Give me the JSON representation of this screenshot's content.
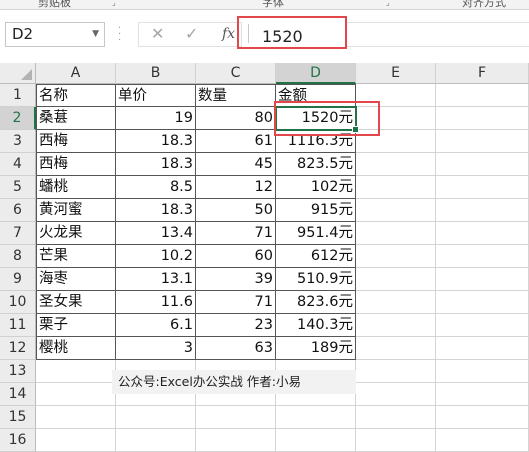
{
  "ribbon": {
    "groups": [
      "剪贴板",
      "字体",
      "对齐方式"
    ]
  },
  "formula_bar": {
    "name_box": "D2",
    "value": "1520",
    "cancel_icon": "✕",
    "enter_icon": "✓",
    "fx_label": "fx"
  },
  "sheet": {
    "columns": [
      "A",
      "B",
      "C",
      "D",
      "E",
      "F"
    ],
    "rows": [
      "1",
      "2",
      "3",
      "4",
      "5",
      "6",
      "7",
      "8",
      "9",
      "10",
      "11",
      "12",
      "13",
      "14",
      "15",
      "16"
    ],
    "header": [
      "名称",
      "单价",
      "数量",
      "金额"
    ],
    "data": [
      [
        "桑葚",
        "19",
        "80",
        "1520元"
      ],
      [
        "西梅",
        "18.3",
        "61",
        "1116.3元"
      ],
      [
        "西梅",
        "18.3",
        "45",
        "823.5元"
      ],
      [
        "蟠桃",
        "8.5",
        "12",
        "102元"
      ],
      [
        "黄河蜜",
        "18.3",
        "50",
        "915元"
      ],
      [
        "火龙果",
        "13.4",
        "71",
        "951.4元"
      ],
      [
        "芒果",
        "10.2",
        "60",
        "612元"
      ],
      [
        "海枣",
        "13.1",
        "39",
        "510.9元"
      ],
      [
        "圣女果",
        "11.6",
        "71",
        "823.6元"
      ],
      [
        "栗子",
        "6.1",
        "23",
        "140.3元"
      ],
      [
        "樱桃",
        "3",
        "63",
        "189元"
      ]
    ],
    "active_cell": "D2"
  },
  "watermark": "公众号:Excel办公实战 作者:小易",
  "colors": {
    "accent": "#217346",
    "highlight": "#e2474b"
  }
}
